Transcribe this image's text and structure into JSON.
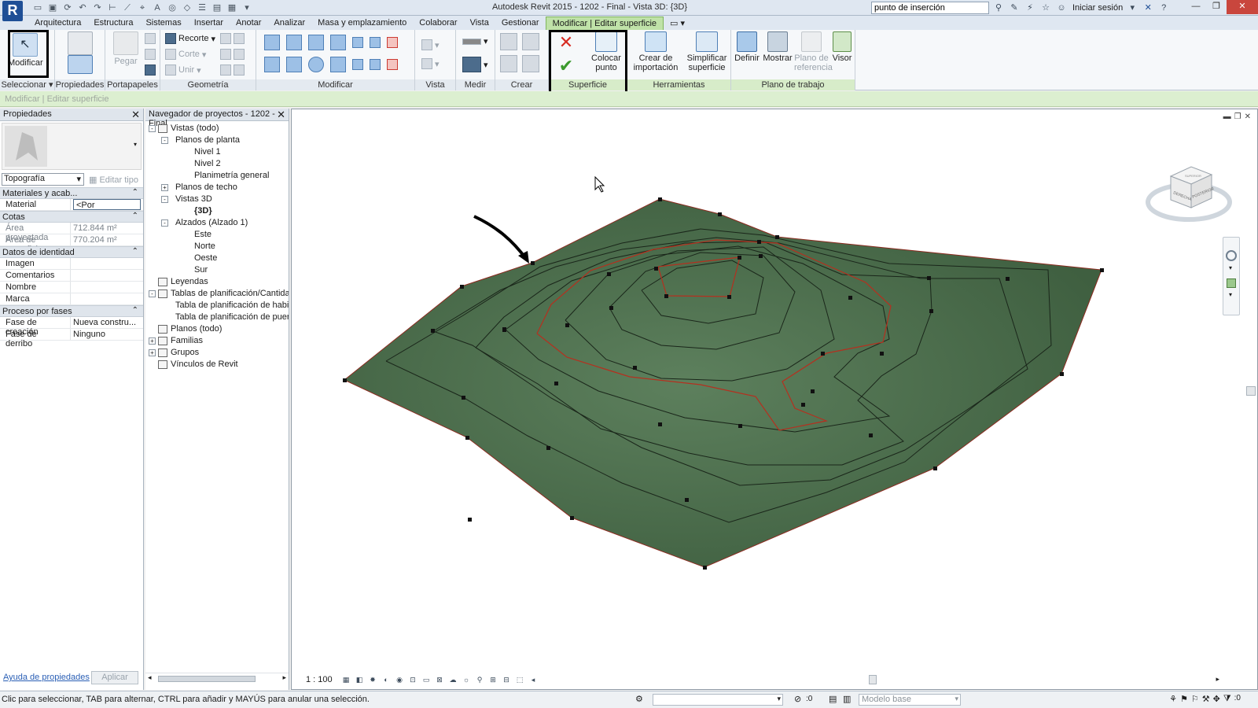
{
  "app": {
    "title": "Autodesk Revit 2015 -      1202 - Final - Vista 3D: {3D}",
    "logo": "R"
  },
  "search": {
    "value": "punto de inserción"
  },
  "signin": "Iniciar sesión",
  "tabs": [
    {
      "label": "Arquitectura"
    },
    {
      "label": "Estructura"
    },
    {
      "label": "Sistemas"
    },
    {
      "label": "Insertar"
    },
    {
      "label": "Anotar"
    },
    {
      "label": "Analizar"
    },
    {
      "label": "Masa y emplazamiento"
    },
    {
      "label": "Colaborar"
    },
    {
      "label": "Vista"
    },
    {
      "label": "Gestionar"
    },
    {
      "label": "Modificar | Editar superficie"
    }
  ],
  "ribbon": {
    "modify_label": "Modificar",
    "select_label": "Seleccionar",
    "properties_label": "Propiedades",
    "paste_label": "Pegar",
    "clipboard_label": "Portapapeles",
    "cope_label": "Recorte",
    "cut_label": "Corte",
    "join_label": "Unir",
    "geometry_label": "Geometría",
    "modify_panel_label": "Modificar",
    "view_panel_label": "Vista",
    "measure_panel_label": "Medir",
    "create_panel_label": "Crear",
    "surface_panel_label": "Superficie",
    "place_point_label": "Colocar punto",
    "create_import_label": "Crear de importación",
    "simplify_label": "Simplificar superficie",
    "tools_panel_label": "Herramientas",
    "define_label": "Definir",
    "show_label": "Mostrar",
    "ref_plane_label": "Plano de referencia",
    "viewer_label": "Visor",
    "workplane_panel_label": "Plano de trabajo"
  },
  "context_bar": "Modificar | Editar superficie",
  "properties": {
    "header": "Propiedades",
    "type_value": "Topografía",
    "edit_type": "Editar tipo",
    "categories": [
      {
        "name": "Materiales y acab...",
        "rows": [
          {
            "name": "Material",
            "value": "<Por categoría>",
            "readonly": false
          }
        ]
      },
      {
        "name": "Cotas",
        "rows": [
          {
            "name": "Área proyectada",
            "value": "712.844 m²",
            "readonly": true
          },
          {
            "name": "Área de superficie",
            "value": "770.204 m²",
            "readonly": true
          }
        ]
      },
      {
        "name": "Datos de identidad",
        "rows": [
          {
            "name": "Imagen",
            "value": "",
            "readonly": false
          },
          {
            "name": "Comentarios",
            "value": "",
            "readonly": false
          },
          {
            "name": "Nombre",
            "value": "",
            "readonly": false
          },
          {
            "name": "Marca",
            "value": "",
            "readonly": false
          }
        ]
      },
      {
        "name": "Proceso por fases",
        "rows": [
          {
            "name": "Fase de creación",
            "value": "Nueva constru...",
            "readonly": false
          },
          {
            "name": "Fase de derribo",
            "value": "Ninguno",
            "readonly": false
          }
        ]
      }
    ],
    "help_link": "Ayuda de propiedades",
    "apply": "Aplicar"
  },
  "browser": {
    "header": "Navegador de proyectos - 1202 - Final",
    "tree": [
      {
        "label": "Vistas (todo)",
        "level": 0,
        "toggle": "-"
      },
      {
        "label": "Planos de planta",
        "level": 1,
        "toggle": "-"
      },
      {
        "label": "Nivel 1",
        "level": 2,
        "toggle": ""
      },
      {
        "label": "Nivel 2",
        "level": 2,
        "toggle": ""
      },
      {
        "label": "Planimetría general",
        "level": 2,
        "toggle": ""
      },
      {
        "label": "Planos de techo",
        "level": 1,
        "toggle": "+"
      },
      {
        "label": "Vistas 3D",
        "level": 1,
        "toggle": "-"
      },
      {
        "label": "{3D}",
        "level": 2,
        "toggle": "",
        "bold": true
      },
      {
        "label": "Alzados (Alzado 1)",
        "level": 1,
        "toggle": "-"
      },
      {
        "label": "Este",
        "level": 2,
        "toggle": ""
      },
      {
        "label": "Norte",
        "level": 2,
        "toggle": ""
      },
      {
        "label": "Oeste",
        "level": 2,
        "toggle": ""
      },
      {
        "label": "Sur",
        "level": 2,
        "toggle": ""
      },
      {
        "label": "Leyendas",
        "level": 0,
        "toggle": ""
      },
      {
        "label": "Tablas de planificación/Cantidades",
        "level": 0,
        "toggle": "-"
      },
      {
        "label": "Tabla de planificación de habitaciones",
        "level": 1,
        "toggle": ""
      },
      {
        "label": "Tabla de planificación de puertas",
        "level": 1,
        "toggle": ""
      },
      {
        "label": "Planos (todo)",
        "level": 0,
        "toggle": ""
      },
      {
        "label": "Familias",
        "level": 0,
        "toggle": "+"
      },
      {
        "label": "Grupos",
        "level": 0,
        "toggle": "+"
      },
      {
        "label": "Vínculos de Revit",
        "level": 0,
        "toggle": ""
      }
    ]
  },
  "viewport": {
    "scale": "1 : 100",
    "viewcube": {
      "left": "DERECHA",
      "right": "POSTERIOR",
      "top": "SUPERIOR"
    },
    "colors": {
      "terrain": "#4a6f4a",
      "contour": "#1e2a1e",
      "highlight": "#b5301f",
      "point": "#111111"
    }
  },
  "status": {
    "text": "Clic para seleccionar, TAB para alternar, CTRL para añadir y MAYÚS para anular una selección.",
    "zero": ":0",
    "model": "Modelo base",
    "filter": ":0"
  }
}
